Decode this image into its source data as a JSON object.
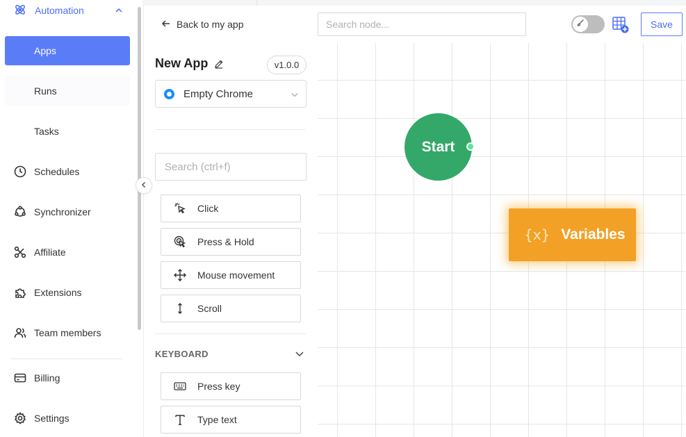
{
  "sidebar": {
    "group": {
      "label": "Automation",
      "icon": "atom-icon"
    },
    "sub_items": [
      {
        "label": "Apps",
        "active": true
      },
      {
        "label": "Runs"
      },
      {
        "label": "Tasks"
      }
    ],
    "items": [
      {
        "label": "Schedules",
        "icon": "clock-icon"
      },
      {
        "label": "Synchronizer",
        "icon": "sync-icon"
      },
      {
        "label": "Affiliate",
        "icon": "affiliate-icon"
      },
      {
        "label": "Extensions",
        "icon": "puzzle-icon"
      },
      {
        "label": "Team members",
        "icon": "users-icon"
      },
      {
        "label": "Billing",
        "icon": "card-icon"
      },
      {
        "label": "Settings",
        "icon": "gear-icon"
      }
    ]
  },
  "panel": {
    "back_label": "Back to my app",
    "app_name": "New App",
    "version": "v1.0.0",
    "browser": "Empty Chrome",
    "search_placeholder": "Search (ctrl+f)",
    "actions": [
      {
        "label": "Click",
        "icon": "click-icon"
      },
      {
        "label": "Press & Hold",
        "icon": "press-hold-icon"
      },
      {
        "label": "Mouse movement",
        "icon": "move-icon"
      },
      {
        "label": "Scroll",
        "icon": "scroll-icon"
      }
    ],
    "keyboard_section": {
      "title": "KEYBOARD",
      "actions": [
        {
          "label": "Press key",
          "icon": "keyboard-icon"
        },
        {
          "label": "Type text",
          "icon": "text-icon"
        }
      ]
    }
  },
  "toolbar": {
    "search_placeholder": "Search node...",
    "save_label": "Save"
  },
  "canvas": {
    "start_label": "Start",
    "variables_symbol": "{x}",
    "variables_label": "Variables"
  },
  "colors": {
    "accent": "#4a6cf7",
    "active_bg": "#5b7cf7",
    "start_node": "#34a868",
    "variables_node": "#f2a126"
  }
}
